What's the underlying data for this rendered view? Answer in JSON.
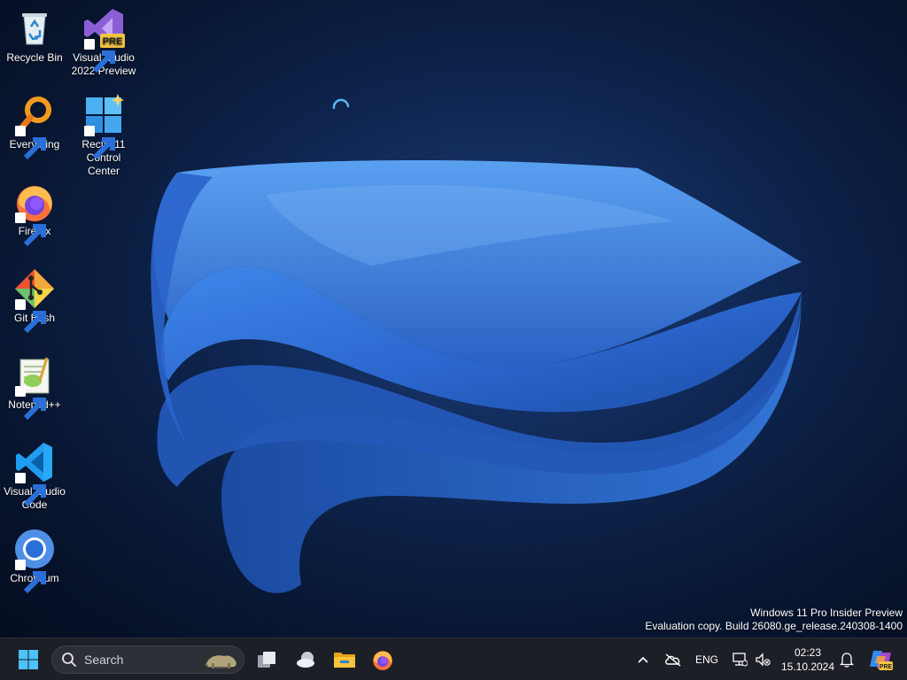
{
  "desktop": {
    "icons": [
      {
        "label": "Recycle Bin",
        "icon": "recycle-bin-icon"
      },
      {
        "label": "Visual Studio 2022 Preview",
        "icon": "visual-studio-preview-icon",
        "badge": "PRE"
      },
      {
        "label": "Everything",
        "icon": "everything-search-icon"
      },
      {
        "label": "Rectify11 Control Center",
        "icon": "rectify11-icon"
      },
      {
        "label": "Firefox",
        "icon": "firefox-icon"
      },
      {
        "label": "Git Bash",
        "icon": "git-bash-icon"
      },
      {
        "label": "Notepad++",
        "icon": "notepad-plus-plus-icon"
      },
      {
        "label": "Visual Studio Code",
        "icon": "vscode-icon"
      },
      {
        "label": "Chromium",
        "icon": "chromium-icon"
      }
    ],
    "watermark": {
      "line1": "Windows 11 Pro Insider Preview",
      "line2": "Evaluation copy. Build 26080.ge_release.240308-1400"
    }
  },
  "taskbar": {
    "start": {
      "icon": "windows-logo-icon"
    },
    "search": {
      "label": "Search",
      "icon": "search-icon"
    },
    "pinned": [
      {
        "name": "task-view",
        "icon": "task-view-icon"
      },
      {
        "name": "widgets",
        "icon": "weather-widget-icon"
      },
      {
        "name": "file-explorer",
        "icon": "folder-icon"
      },
      {
        "name": "firefox",
        "icon": "firefox-icon"
      }
    ],
    "tray": {
      "language": "ENG",
      "time": "02:23",
      "date": "15.10.2024",
      "copilot_badge": "PRE"
    }
  },
  "colors": {
    "desktop_bg": "#0a1c3d",
    "ribbon": "#2f6fd6",
    "taskbar": "#1c1f26",
    "accent": "#4cc2ff"
  }
}
